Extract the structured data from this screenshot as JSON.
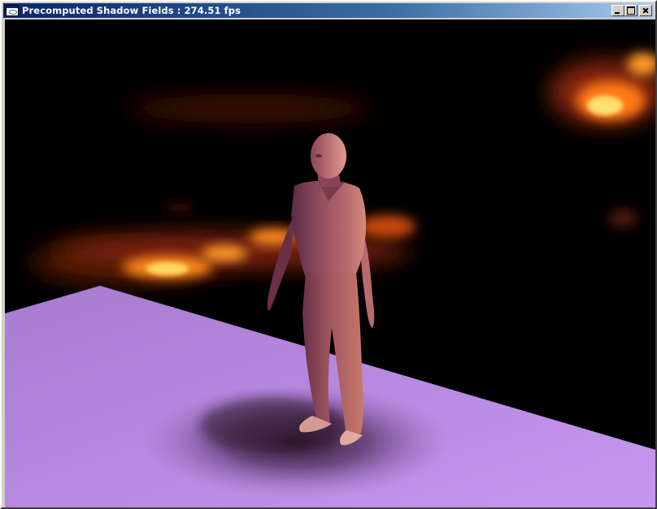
{
  "window": {
    "title": "Precomputed Shadow Fields : 274.51 fps",
    "controls": {
      "minimize": "minimize-icon",
      "maximize": "maximize-icon",
      "close": "close-icon"
    }
  },
  "scene": {
    "background_color": "#000000",
    "floor_color": "#b889e0",
    "figure_color": "#a85a68",
    "light_color": "#ff9a2a"
  }
}
